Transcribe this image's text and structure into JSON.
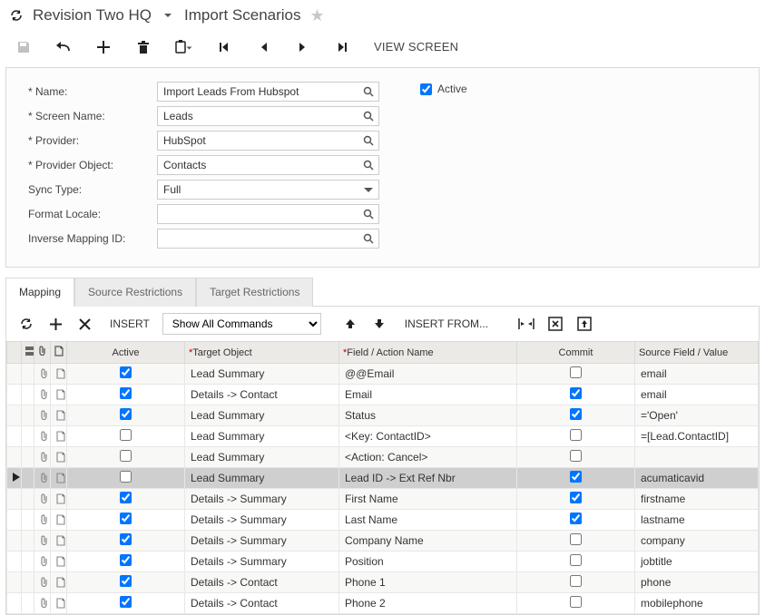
{
  "title": {
    "company": "Revision Two HQ",
    "page": "Import Scenarios"
  },
  "toolbar": {
    "view_screen": "VIEW SCREEN"
  },
  "form": {
    "labels": {
      "name": "Name:",
      "screen_name": "Screen Name:",
      "provider": "Provider:",
      "provider_object": "Provider Object:",
      "sync_type": "Sync Type:",
      "format_locale": "Format Locale:",
      "inverse_mapping": "Inverse Mapping ID:",
      "active": "Active"
    },
    "values": {
      "name": "Import Leads From Hubspot",
      "screen_name": "Leads",
      "provider": "HubSpot",
      "provider_object": "Contacts",
      "sync_type": "Full",
      "format_locale": "",
      "inverse_mapping": ""
    },
    "active_checked": true
  },
  "tabs": {
    "mapping": "Mapping",
    "source_restrictions": "Source Restrictions",
    "target_restrictions": "Target Restrictions"
  },
  "grid_toolbar": {
    "insert": "INSERT",
    "filter_value": "Show All Commands",
    "insert_from": "INSERT FROM..."
  },
  "grid": {
    "headers": {
      "active": "Active",
      "target_object": "Target Object",
      "field": "Field / Action Name",
      "commit": "Commit",
      "source": "Source Field / Value"
    },
    "rows": [
      {
        "active": true,
        "target": "Lead Summary",
        "field": "@@Email",
        "commit": false,
        "source": "email",
        "selected": false
      },
      {
        "active": true,
        "target": "Details -> Contact",
        "field": "Email",
        "commit": true,
        "source": "email",
        "selected": false
      },
      {
        "active": true,
        "target": "Lead Summary",
        "field": "Status",
        "commit": true,
        "source": "='Open'",
        "selected": false
      },
      {
        "active": false,
        "target": "Lead Summary",
        "field": "<Key: ContactID>",
        "commit": false,
        "source": "=[Lead.ContactID]",
        "selected": false
      },
      {
        "active": false,
        "target": "Lead Summary",
        "field": "<Action: Cancel>",
        "commit": false,
        "source": "",
        "selected": false
      },
      {
        "active": false,
        "target": "Lead Summary",
        "field": "Lead ID -> Ext Ref Nbr",
        "commit": true,
        "source": "acumaticavid",
        "selected": true
      },
      {
        "active": true,
        "target": "Details -> Summary",
        "field": "First Name",
        "commit": true,
        "source": "firstname",
        "selected": false
      },
      {
        "active": true,
        "target": "Details -> Summary",
        "field": "Last Name",
        "commit": true,
        "source": "lastname",
        "selected": false
      },
      {
        "active": true,
        "target": "Details -> Summary",
        "field": "Company Name",
        "commit": false,
        "source": "company",
        "selected": false
      },
      {
        "active": true,
        "target": "Details -> Summary",
        "field": "Position",
        "commit": false,
        "source": "jobtitle",
        "selected": false
      },
      {
        "active": true,
        "target": "Details -> Contact",
        "field": "Phone 1",
        "commit": false,
        "source": "phone",
        "selected": false
      },
      {
        "active": true,
        "target": "Details -> Contact",
        "field": "Phone 2",
        "commit": false,
        "source": "mobilephone",
        "selected": false
      }
    ]
  }
}
